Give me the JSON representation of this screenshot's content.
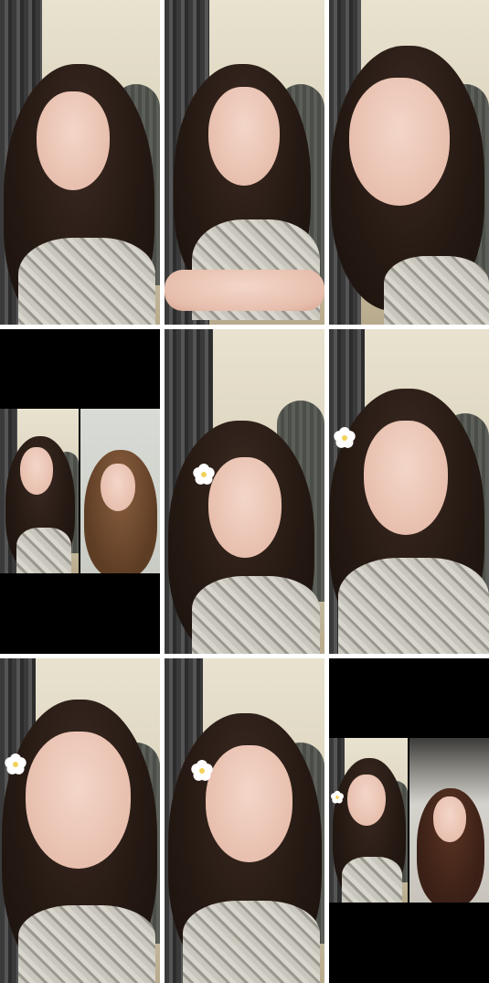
{
  "grid": {
    "rows": 3,
    "columns": 3,
    "tiles": [
      {
        "type": "photo",
        "flower": false
      },
      {
        "type": "photo",
        "flower": false
      },
      {
        "type": "photo",
        "flower": false
      },
      {
        "type": "split",
        "flower": false
      },
      {
        "type": "photo",
        "flower": true
      },
      {
        "type": "photo",
        "flower": true
      },
      {
        "type": "photo",
        "flower": true
      },
      {
        "type": "photo",
        "flower": true
      },
      {
        "type": "split",
        "flower": true
      }
    ]
  },
  "colors": {
    "background": "#ffffff",
    "letterbox": "#000000",
    "wall": "#d8d1bf",
    "hair": "#241812",
    "skin": "#e8bfae"
  }
}
